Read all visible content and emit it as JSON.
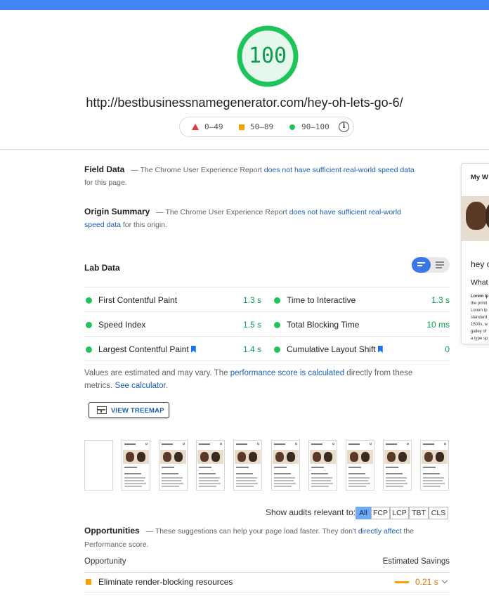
{
  "colors": {
    "accent": "#4285f4",
    "pass": "#0c9d4e",
    "average": "#f4a300",
    "fail": "#e53935",
    "link": "#1a5fb4"
  },
  "score": {
    "value": "100",
    "ring_fraction": 1.0
  },
  "url": "http://bestbusinessnamegenerator.com/hey-oh-lets-go-6/",
  "legend": {
    "fail_range": "0–49",
    "average_range": "50–89",
    "pass_range": "90–100",
    "info_icon": "info-icon"
  },
  "field_data": {
    "title": "Field Data",
    "text_before": "— The Chrome User Experience Report ",
    "link": "does not have sufficient real-world speed data",
    "text_after": " for this page."
  },
  "origin_summary": {
    "title": "Origin Summary",
    "text_before": "— The Chrome User Experience Report ",
    "link": "does not have sufficient real-world speed data",
    "text_after": " for this origin."
  },
  "lab_data": {
    "title": "Lab Data",
    "toggle_icons": [
      "view-list-icon",
      "view-details-icon"
    ],
    "metrics": [
      {
        "name": "First Contentful Paint",
        "value": "1.3 s",
        "bookmark": false
      },
      {
        "name": "Time to Interactive",
        "value": "1.3 s",
        "bookmark": false
      },
      {
        "name": "Speed Index",
        "value": "1.5 s",
        "bookmark": false
      },
      {
        "name": "Total Blocking Time",
        "value": "10 ms",
        "bookmark": false
      },
      {
        "name": "Largest Contentful Paint",
        "value": "1.4 s",
        "bookmark": true
      },
      {
        "name": "Cumulative Layout Shift",
        "value": "0",
        "bookmark": true
      }
    ]
  },
  "note": {
    "text1": "Values are estimated and may vary. The ",
    "link1": "performance score is calculated",
    "text2": " directly from these metrics. ",
    "link2": "See calculator",
    "text3": "."
  },
  "treemap": {
    "label": "VIEW TREEMAP",
    "icon": "treemap-icon"
  },
  "filmstrip": {
    "frame_count": 10
  },
  "audits_filter": {
    "label": "Show audits relevant to:",
    "chips": [
      "All",
      "FCP",
      "LCP",
      "TBT",
      "CLS"
    ],
    "active": "All"
  },
  "opportunities": {
    "title": "Opportunities",
    "text_before": "— These suggestions can help your page load faster. They don't ",
    "link": "directly affect",
    "text_after": " the Performance score.",
    "col_opportunity": "Opportunity",
    "col_savings": "Estimated Savings",
    "items": [
      {
        "name": "Eliminate render-blocking resources",
        "savings": "0.21 s"
      }
    ]
  },
  "preview": {
    "title": "My W",
    "heading": "hey o",
    "subheading": "What",
    "lines": [
      "Lorem Ip",
      "the printi",
      "Lorem Ip",
      "standard",
      "1500s, w",
      "galley of",
      "a type sp"
    ]
  }
}
